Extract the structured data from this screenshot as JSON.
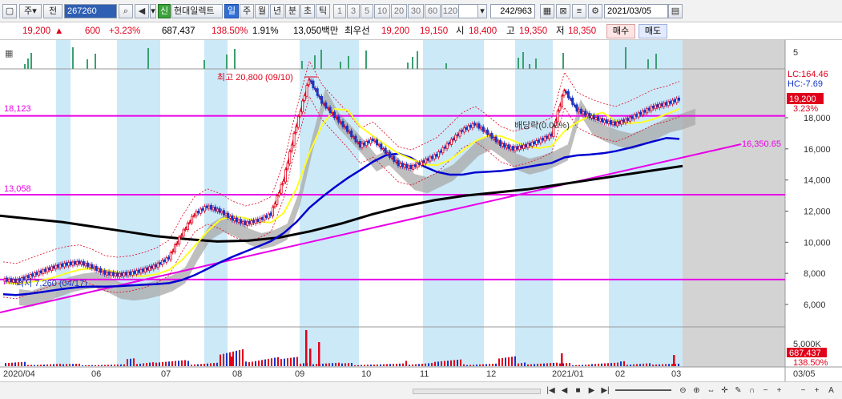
{
  "toolbar": {
    "market_label": "주",
    "type_label": "전",
    "code_value": "267260",
    "company_tag": "신",
    "company_name": "현대일렉트",
    "period_tabs": [
      "일",
      "주",
      "월",
      "년",
      "분",
      "초",
      "틱"
    ],
    "selected_period": "일",
    "interval_tabs": [
      "1",
      "3",
      "5",
      "10",
      "20",
      "30",
      "60",
      "120"
    ],
    "count_value": "242/963",
    "date_value": "2021/03/05"
  },
  "quote": {
    "price": "19,200",
    "change_arrow": "▲",
    "change": "600",
    "change_pct": "+3.23%",
    "volume": "687,437",
    "volume_ratio": "138.50%",
    "turnover": "1.91%",
    "amount": "13,050백만",
    "best_ask_label": "최우선",
    "best_ask": "19,200",
    "best_bid": "19,150",
    "open_label": "시",
    "open": "18,400",
    "high_label": "고",
    "high": "19,350",
    "low_label": "저",
    "low": "18,350",
    "buy_label": "매수",
    "sell_label": "매도"
  },
  "chart_labels": {
    "high_annotation": "최고 20,800 (09/10)",
    "low_annotation": "최저 7,260 (04/17)",
    "dividend_annotation": "배당락(0.00%)",
    "level_upper": "18,123",
    "level_mid": "13,058",
    "trendline_value": "16,350.65",
    "lc_value": "LC:164.46",
    "hc_value": "HC:-7.69",
    "last_price_box": "19,200",
    "last_change_box": "3.23%",
    "left_small_label": "7",
    "volume_axis_top": "5,000K",
    "volume_box": "687,437",
    "volume_pct_box": "138.50%",
    "small_chart_axis": "5"
  },
  "chart_data": {
    "type": "candlestick",
    "y_ticks": [
      "18,000",
      "16,000",
      "14,000",
      "12,000",
      "10,000",
      "8,000",
      "6,000"
    ],
    "y_tick_values": [
      18000,
      16000,
      14000,
      12000,
      10000,
      8000,
      6000
    ],
    "x_labels": [
      "2020/04",
      "06",
      "07",
      "08",
      "09",
      "10",
      "11",
      "12",
      "2021/01",
      "02",
      "03",
      "03/05"
    ],
    "horizontal_levels": [
      18123,
      13058,
      7600
    ],
    "close_path": [
      7600,
      7500,
      7800,
      8100,
      8400,
      8600,
      8700,
      8400,
      8000,
      7900,
      8000,
      8200,
      8500,
      9000,
      10500,
      11800,
      12300,
      12000,
      11500,
      11200,
      11400,
      11800,
      14000,
      17500,
      20500,
      19000,
      18100,
      17200,
      16200,
      16600,
      15800,
      15000,
      14800,
      15200,
      15600,
      16400,
      17200,
      17600,
      17000,
      16300,
      16000,
      16200,
      16500,
      16900,
      19800,
      18500,
      18100,
      17800,
      17600,
      17900,
      18300,
      18700,
      18900,
      19200
    ],
    "ma_long_path": [
      11700,
      11500,
      11300,
      11000,
      10700,
      10400,
      10200,
      10050,
      10100,
      10300,
      10700,
      11200,
      11800,
      12300,
      12700,
      13000,
      13200,
      13400,
      13700,
      14000,
      14300,
      14600,
      14900
    ],
    "volume_spikes": [
      1200,
      900,
      700,
      600,
      2200,
      1800,
      1500,
      4800,
      3500,
      2600,
      1200,
      900,
      800,
      1500,
      1900,
      1000,
      2800,
      1200,
      900,
      1100,
      1400,
      700
    ]
  },
  "colors": {
    "up": "#e0001b",
    "down": "#1536c8",
    "level_line": "#e800e8",
    "trend_line": "#e800e8",
    "ma_blue": "#0000d0",
    "ma_black": "#000000",
    "ma_yellow": "#ffff20",
    "shade": "#cce9f8",
    "cloud": "#a8a8a8",
    "grey_area": "#d3d3d3"
  }
}
